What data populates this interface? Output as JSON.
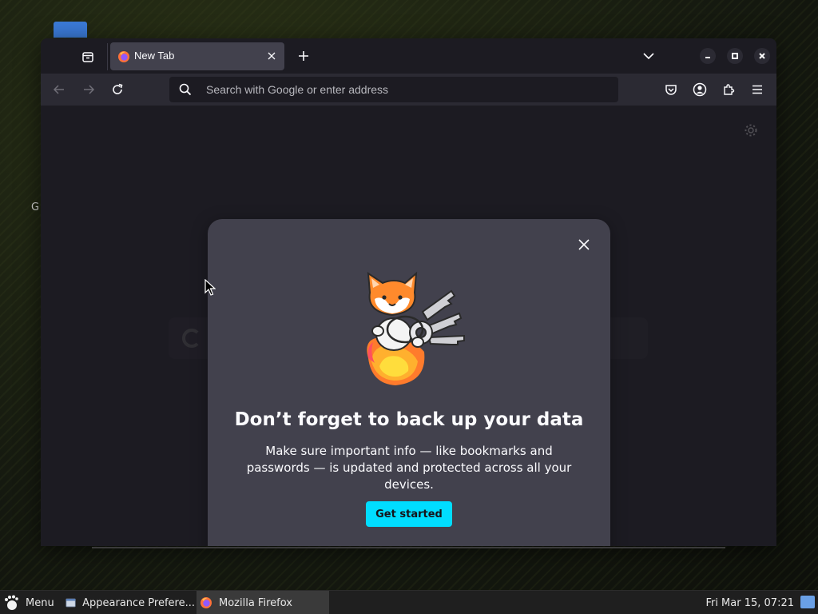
{
  "desktop": {
    "stray_letter": "G"
  },
  "browser": {
    "tab": {
      "title": "New Tab"
    },
    "urlbar": {
      "placeholder": "Search with Google or enter address"
    }
  },
  "modal": {
    "title": "Don’t forget to back up your data",
    "body": "Make sure important info — like bookmarks and passwords — is updated and protected across all your devices.",
    "cta_label": "Get started",
    "accent_color": "#00ddff"
  },
  "taskbar": {
    "menu_label": "Menu",
    "items": [
      {
        "label": "Appearance Prefere..."
      },
      {
        "label": "Mozilla Firefox"
      }
    ],
    "clock": "Fri Mar 15, 07:21"
  }
}
